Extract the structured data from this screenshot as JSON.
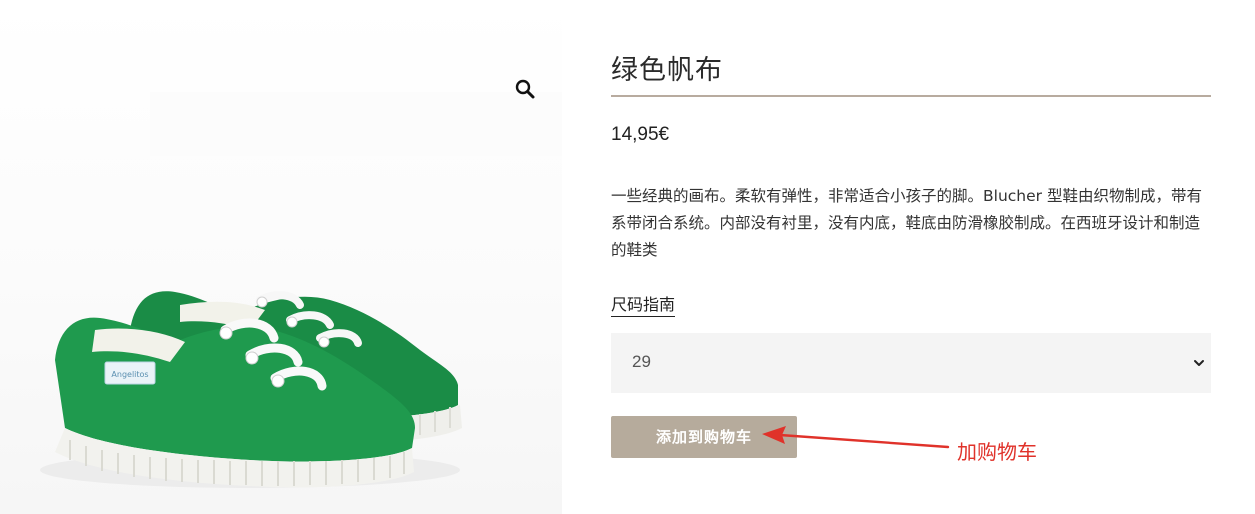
{
  "product": {
    "title": "绿色帆布",
    "price": "14,95€",
    "description": "一些经典的画布。柔软有弹性，非常适合小孩子的脚。Blucher 型鞋由织物制成，带有系带闭合系统。内部没有衬里，没有内底，鞋底由防滑橡胶制成。在西班牙设计和制造的鞋类",
    "image_alt": "Green canvas sneakers",
    "label_text": "Angelitos"
  },
  "size": {
    "guide_label": "尺码指南",
    "selected": "29"
  },
  "cart": {
    "button_label": "添加到购物车"
  },
  "annotation": {
    "label": "加购物车",
    "color": "#e0322a"
  },
  "icons": {
    "zoom": "magnifier-icon",
    "select": "chevron-down-icon"
  },
  "colors": {
    "button": "#b6ab9c",
    "rule": "#b8ab9f",
    "shoe": "#1f9a4e",
    "select_bg": "#f4f4f4"
  }
}
